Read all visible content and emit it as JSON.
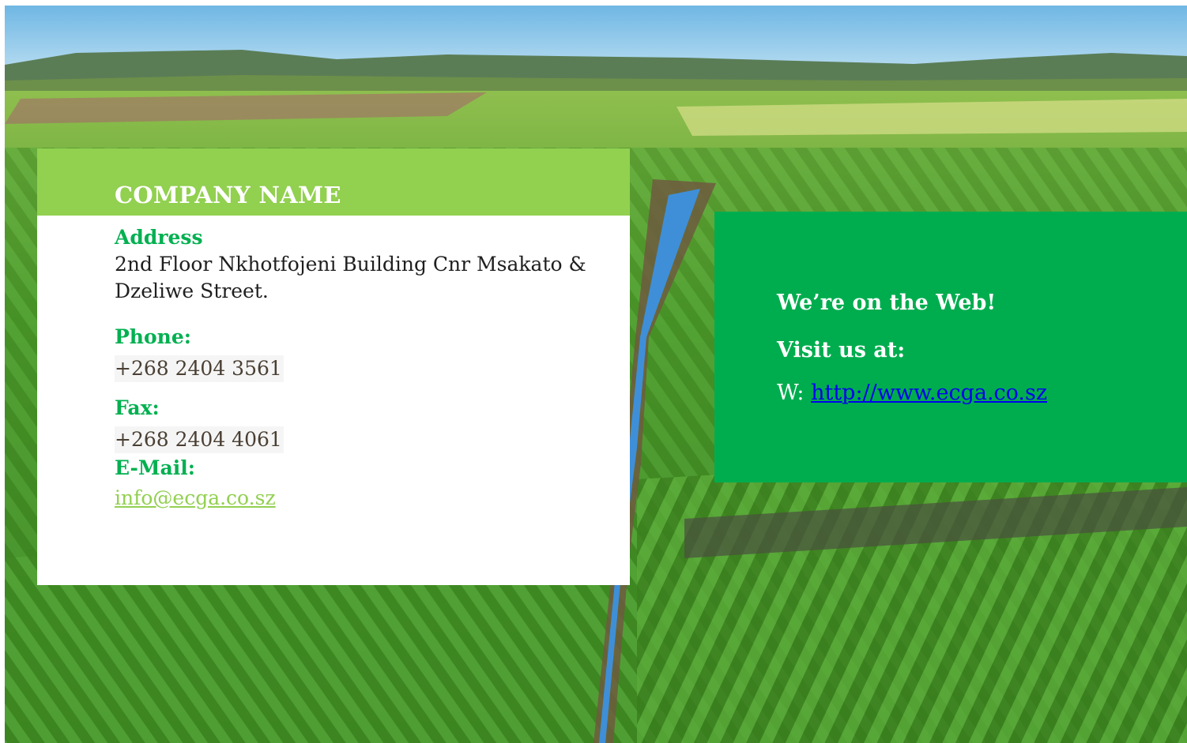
{
  "contact": {
    "company_name": "COMPANY NAME",
    "address_label": "Address",
    "address_value": "2nd Floor Nkhotfojeni Building Cnr Msakato & Dzeliwe Street.",
    "phone_label": "Phone:",
    "phone_value": "+268 2404 3561",
    "fax_label": "Fax:",
    "fax_value": "+268 2404 4061",
    "email_label": "E-Mail:",
    "email_value": "info@ecga.co.sz"
  },
  "web": {
    "heading": "We’re on the Web!",
    "visit_label": "Visit us at:",
    "url_prefix": "W: ",
    "url": "http://www.ecga.co.sz"
  },
  "colors": {
    "header_green": "#92d050",
    "label_green": "#00b050",
    "web_panel_green": "#00ad4e",
    "link_blue": "#0000ee"
  }
}
